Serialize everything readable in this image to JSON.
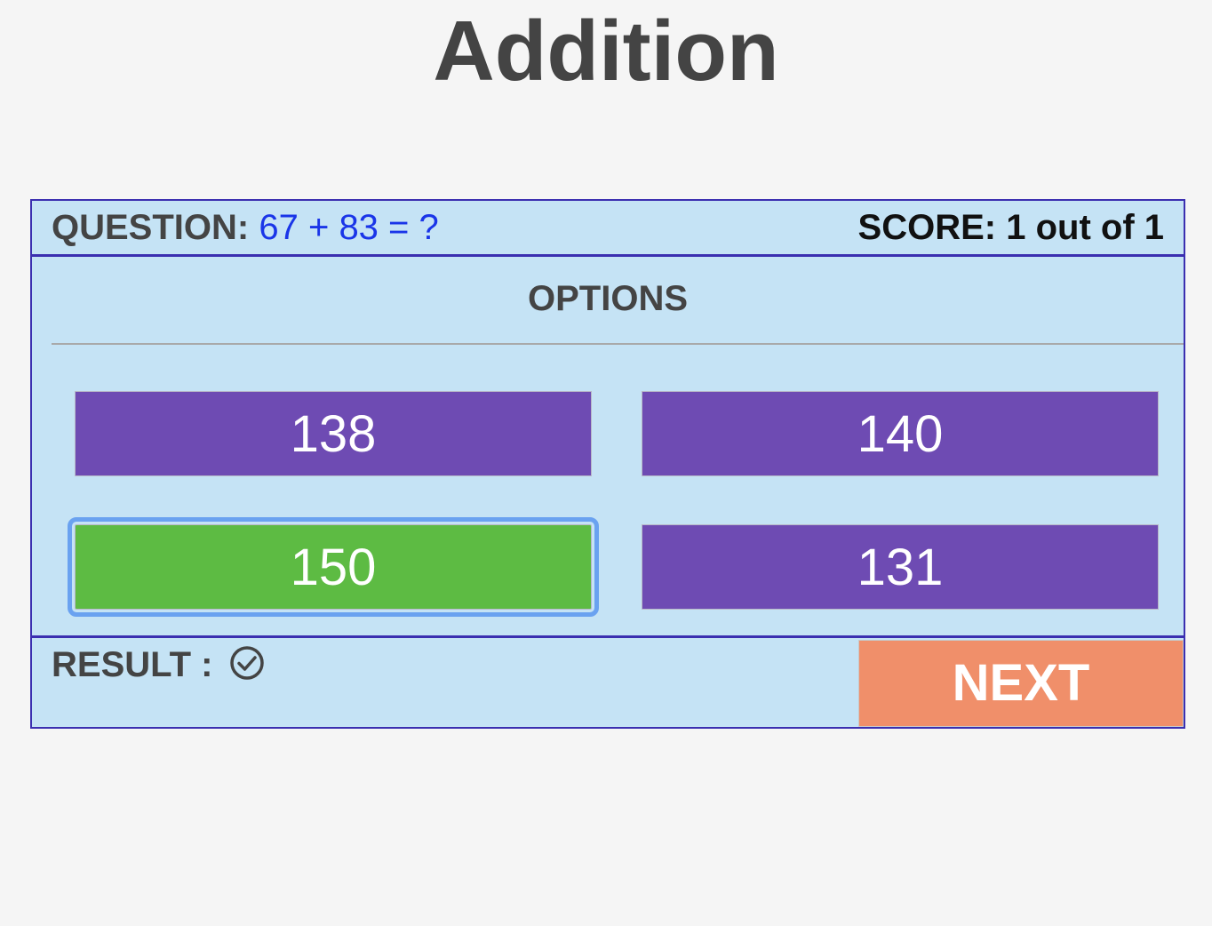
{
  "title": "Addition",
  "header": {
    "question_label": "QUESTION:",
    "question_text": "67 + 83 = ?",
    "score_text": "SCORE: 1 out of 1"
  },
  "options_title": "OPTIONS",
  "options": [
    {
      "label": "138",
      "state": "default"
    },
    {
      "label": "140",
      "state": "default"
    },
    {
      "label": "150",
      "state": "correct-selected"
    },
    {
      "label": "131",
      "state": "default"
    }
  ],
  "footer": {
    "result_label": "RESULT :",
    "result_icon": "check-circle-icon",
    "next_label": "NEXT"
  },
  "colors": {
    "panel_bg": "#c5e3f5",
    "panel_border": "#3b2fb0",
    "option_default": "#6e4bb3",
    "option_correct": "#5dbb43",
    "selected_outline": "#6aa2f0",
    "next_button": "#f08f6a",
    "question_text": "#1a35e8"
  }
}
